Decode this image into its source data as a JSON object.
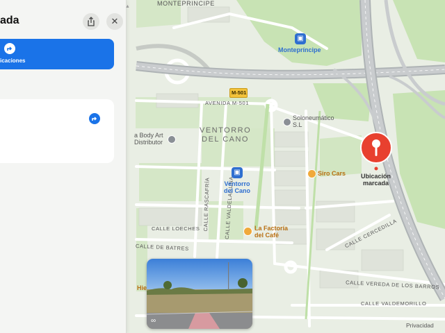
{
  "panel": {
    "title": "ada",
    "route_label": "icaciones",
    "share_icon": "share-icon",
    "close_icon": "close-icon",
    "close_glyph": "✕",
    "route_icon": "turn-arrow-icon",
    "drag_glyph": "▲"
  },
  "map": {
    "top_label": "MONTEPRINCIPE",
    "road_badge": "M-501",
    "district": [
      "VENTORRO",
      "DEL CANO"
    ],
    "streets": {
      "avenida": "AVENIDA M-501",
      "loeches": "CALLE LOECHES",
      "batres": "CALLE DE BATRES",
      "rascafria": "CALLE RASCAFRÍA",
      "valdelaguna": "CALLE VALDELAGUNA",
      "cercedilla": "CALLE CERCEDILLA",
      "vereda": "CALLE VEREDA DE LOS BARROS",
      "valdemorillo": "CALLE VALDEMORILLO"
    },
    "pois": {
      "monteprincipe_station": "Montepríncipe",
      "ventorro_station": [
        "Ventorro",
        "del Cano"
      ],
      "body_art": [
        "a Body Art",
        "Distributor"
      ],
      "soloneumatico": [
        "Soloneumático",
        "S.L"
      ],
      "siro_cars": "Siro Cars",
      "factoria": [
        "La Factoría",
        "del Café"
      ],
      "edge_fragment": "Hie"
    },
    "pin_label": [
      "Ubicación",
      "marcada"
    ],
    "privacy": "Privacidad",
    "binoculars_icon": "binoculars-icon"
  },
  "colors": {
    "accent": "#1a73e8",
    "pin": "#e8402f",
    "map_land": "#e9eee4",
    "park": "#c8e3b4",
    "highway": "#b7bbbe"
  }
}
